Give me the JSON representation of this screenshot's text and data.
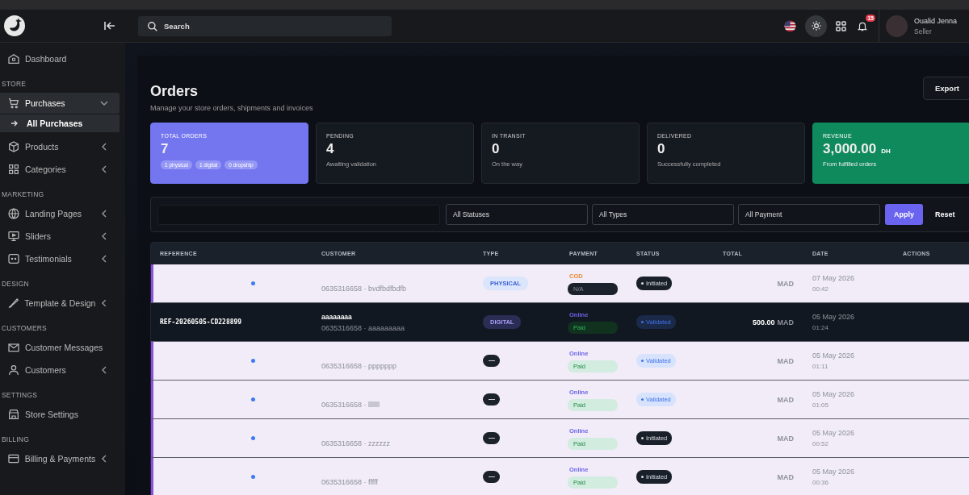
{
  "header": {
    "search": {
      "placeholder": "Search"
    },
    "notifications": "15",
    "user": {
      "name": "Oualid Jenna",
      "role": "Seller"
    }
  },
  "sidebar": {
    "sections": [
      {
        "items": [
          {
            "label": "Dashboard",
            "expandable": false,
            "selected": false
          }
        ]
      },
      {
        "title": "STORE",
        "items": [
          {
            "label": "Purchases",
            "expandable": true,
            "expanded": true,
            "selected": true,
            "children": [
              {
                "label": "All Purchases",
                "selected": true
              }
            ]
          },
          {
            "label": "Products",
            "expandable": true,
            "expanded": false,
            "selected": false
          },
          {
            "label": "Categories",
            "expandable": true,
            "expanded": false,
            "selected": false
          }
        ]
      },
      {
        "title": "MARKETING",
        "items": [
          {
            "label": "Landing Pages",
            "expandable": true,
            "expanded": false,
            "selected": false
          },
          {
            "label": "Sliders",
            "expandable": true,
            "expanded": false,
            "selected": false
          },
          {
            "label": "Testimonials",
            "expandable": true,
            "expanded": false,
            "selected": false
          }
        ]
      },
      {
        "title": "DESIGN",
        "items": [
          {
            "label": "Template & Design",
            "expandable": true,
            "expanded": false,
            "selected": false
          }
        ]
      },
      {
        "title": "CUSTOMERS",
        "items": [
          {
            "label": "Customer Messages",
            "expandable": false,
            "selected": false
          },
          {
            "label": "Customers",
            "expandable": true,
            "expanded": false,
            "selected": false
          }
        ]
      },
      {
        "title": "SETTINGS",
        "items": [
          {
            "label": "Store Settings",
            "expandable": false,
            "selected": false
          }
        ]
      },
      {
        "title": "BILLING",
        "items": [
          {
            "label": "Billing & Payments",
            "expandable": true,
            "expanded": false,
            "selected": false
          }
        ]
      }
    ]
  },
  "page": {
    "title": "Orders",
    "subtitle": "Manage your store orders, shipments and invoices",
    "export": "Export"
  },
  "stats": [
    {
      "kind": "primary",
      "label": "TOTAL ORDERS",
      "value": "7",
      "chips": [
        "1 physical",
        "1 digital",
        "0 dropship"
      ]
    },
    {
      "kind": "normal",
      "label": "PENDING",
      "value": "4",
      "note": "Awaiting validation"
    },
    {
      "kind": "normal",
      "label": "IN TRANSIT",
      "value": "0",
      "note": "On the way"
    },
    {
      "kind": "normal",
      "label": "DELIVERED",
      "value": "0",
      "note": "Successfully completed"
    },
    {
      "kind": "success",
      "label": "REVENUE",
      "value": "3,000.00",
      "unit": "DH",
      "note": "From fulfilled orders"
    }
  ],
  "filters": {
    "selects": [
      "All Statuses",
      "All Types",
      "All Payment"
    ],
    "apply": "Apply",
    "reset": "Reset"
  },
  "table": {
    "columns": [
      "REFERENCE",
      "CUSTOMER",
      "TYPE",
      "PAYMENT",
      "STATUS",
      "TOTAL",
      "DATE",
      "ACTIONS"
    ],
    "rows": [
      {
        "unread": true,
        "phone_note": "0635316658 · bvdfbdfbdfb",
        "type": {
          "kind": "physical",
          "label": "PHYSICAL"
        },
        "method": {
          "kind": "cod",
          "label": "COD"
        },
        "paid_state": {
          "kind": "none",
          "label": "N/A"
        },
        "status": {
          "kind": "initiated",
          "label": "Initiated"
        },
        "currency": "MAD",
        "date": "07 May 2026",
        "time": "00:42"
      },
      {
        "unread": false,
        "reference": "REF-20260505-CD228899",
        "customer": "aaaaaaaa",
        "phone_note": "0635316658 · aaaaaaaaa",
        "type": {
          "kind": "digital",
          "label": "DIGITAL"
        },
        "method": {
          "kind": "online",
          "label": "Online"
        },
        "paid_state": {
          "kind": "paid",
          "label": "Paid"
        },
        "status": {
          "kind": "validated",
          "label": "Validated"
        },
        "amount": "500.00",
        "currency": "MAD",
        "date": "05 May 2026",
        "time": "01:24"
      },
      {
        "unread": true,
        "phone_note": "0635316658 · ppppppp",
        "type": {
          "kind": "none"
        },
        "method": {
          "kind": "online",
          "label": "Online"
        },
        "paid_state": {
          "kind": "paid",
          "label": "Paid"
        },
        "status": {
          "kind": "validated",
          "label": "Validated"
        },
        "currency": "MAD",
        "date": "05 May 2026",
        "time": "01:11"
      },
      {
        "unread": true,
        "phone_note": "0635316658 · lllllll",
        "type": {
          "kind": "none"
        },
        "method": {
          "kind": "online",
          "label": "Online"
        },
        "paid_state": {
          "kind": "paid",
          "label": "Paid"
        },
        "status": {
          "kind": "validated",
          "label": "Validated"
        },
        "currency": "MAD",
        "date": "05 May 2026",
        "time": "01:05"
      },
      {
        "unread": true,
        "phone_note": "0635316658 · zzzzzz",
        "type": {
          "kind": "none"
        },
        "method": {
          "kind": "online",
          "label": "Online"
        },
        "paid_state": {
          "kind": "paid",
          "label": "Paid"
        },
        "status": {
          "kind": "initiated",
          "label": "Initiated"
        },
        "currency": "MAD",
        "date": "05 May 2026",
        "time": "00:52"
      },
      {
        "unread": true,
        "phone_note": "0635316658 · fffff",
        "type": {
          "kind": "none"
        },
        "method": {
          "kind": "online",
          "label": "Online"
        },
        "paid_state": {
          "kind": "paid",
          "label": "Paid"
        },
        "status": {
          "kind": "initiated",
          "label": "Initiated"
        },
        "currency": "MAD",
        "date": "05 May 2026",
        "time": "00:36"
      }
    ]
  }
}
